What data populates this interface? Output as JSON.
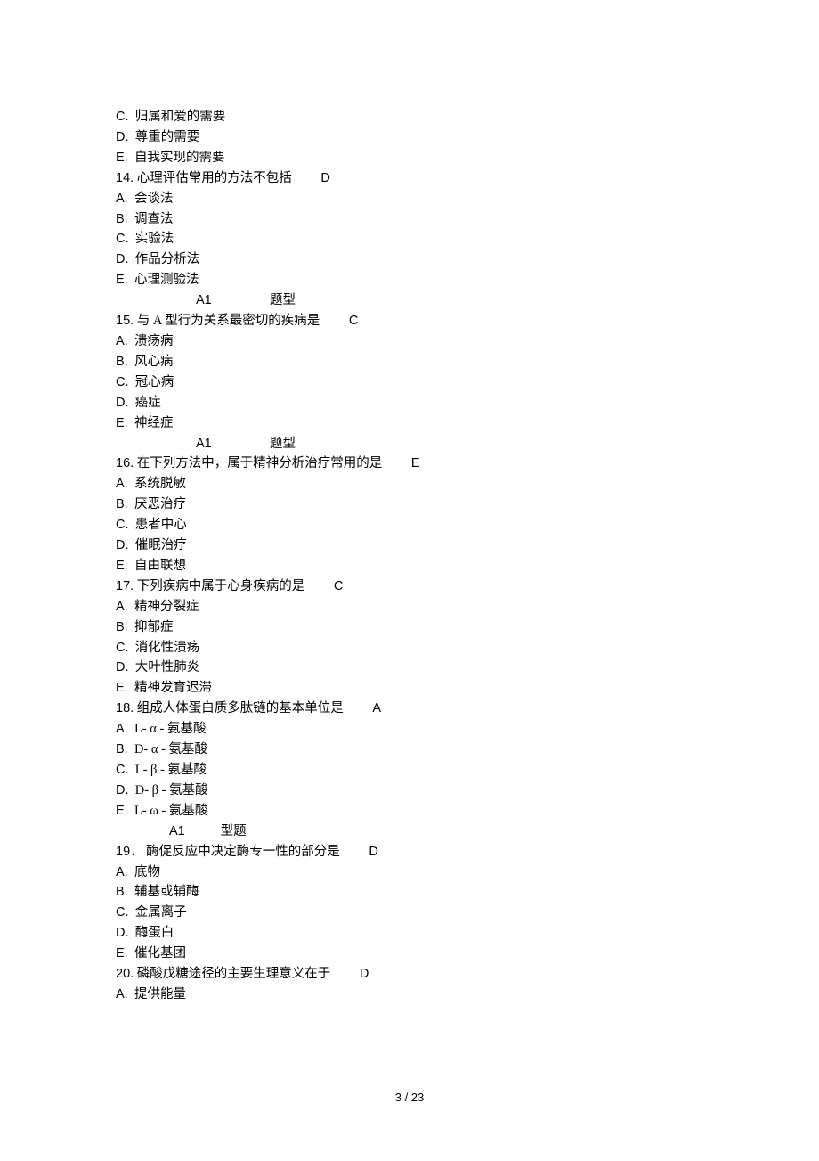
{
  "lines": [
    {
      "t": "opt",
      "label": "C.",
      "text": "归属和爱的需要"
    },
    {
      "t": "opt",
      "label": "D.",
      "text": "尊重的需要"
    },
    {
      "t": "opt",
      "label": "E.",
      "text": "自我实现的需要"
    },
    {
      "t": "q",
      "num": "14.",
      "text": "心理评估常用的方法不包括",
      "ans": "D",
      "gap": "         "
    },
    {
      "t": "opt",
      "label": "A.",
      "text": "会谈法"
    },
    {
      "t": "opt",
      "label": "B.",
      "text": "调查法"
    },
    {
      "t": "opt",
      "label": "C.",
      "text": "实验法"
    },
    {
      "t": "opt",
      "label": "D.",
      "text": "作品分析法"
    },
    {
      "t": "opt",
      "label": "E.",
      "text": "心理测验法"
    },
    {
      "t": "hdr",
      "a1": "A1",
      "mid": "                  ",
      "rest": "题型"
    },
    {
      "t": "q",
      "num": "15.",
      "text": "与 A 型行为关系最密切的疾病是",
      "ans": "C",
      "gap": "         "
    },
    {
      "t": "opt",
      "label": "A.",
      "text": "溃疡病"
    },
    {
      "t": "opt",
      "label": "B.",
      "text": "风心病"
    },
    {
      "t": "opt",
      "label": "C.",
      "text": "冠心病"
    },
    {
      "t": "opt",
      "label": "D.",
      "text": "癌症"
    },
    {
      "t": "opt",
      "label": "E.",
      "text": "神经症"
    },
    {
      "t": "hdr",
      "a1": "A1",
      "mid": "                  ",
      "rest": "题型"
    },
    {
      "t": "q",
      "num": "16.",
      "text": "在下列方法中，属于精神分析治疗常用的是",
      "ans": "E",
      "gap": "         "
    },
    {
      "t": "opt",
      "label": "A.",
      "text": "系统脱敏"
    },
    {
      "t": "opt",
      "label": "B.",
      "text": "厌恶治疗"
    },
    {
      "t": "opt",
      "label": "C.",
      "text": "患者中心"
    },
    {
      "t": "opt",
      "label": "D.",
      "text": "催眠治疗"
    },
    {
      "t": "opt",
      "label": "E.",
      "text": "自由联想"
    },
    {
      "t": "q",
      "num": "17.",
      "text": "下列疾病中属于心身疾病的是",
      "ans": "C",
      "gap": "         "
    },
    {
      "t": "opt",
      "label": "A.",
      "text": "精神分裂症"
    },
    {
      "t": "opt",
      "label": "B.",
      "text": "抑郁症"
    },
    {
      "t": "opt",
      "label": "C.",
      "text": "消化性溃疡"
    },
    {
      "t": "opt",
      "label": "D.",
      "text": "大叶性肺炎"
    },
    {
      "t": "opt",
      "label": "E.",
      "text": "精神发育迟滞"
    },
    {
      "t": "q",
      "num": "18.",
      "text": "组成人体蛋白质多肽链的基本单位是",
      "ans": "A",
      "gap": "         "
    },
    {
      "t": "opt",
      "label": "A.",
      "text": "L- α - 氨基酸"
    },
    {
      "t": "opt",
      "label": "B.",
      "text": "D- α - 氨基酸"
    },
    {
      "t": "opt",
      "label": "C.",
      "text": "L- β - 氨基酸"
    },
    {
      "t": "opt",
      "label": "D.",
      "text": "D- β - 氨基酸"
    },
    {
      "t": "opt",
      "label": "E.",
      "text": "L- ω - 氨基酸"
    },
    {
      "t": "hdr2",
      "a1": "A1",
      "mid": "           ",
      "rest": "型题"
    },
    {
      "t": "q",
      "num": "19．",
      "text": "酶促反应中决定酶专一性的部分是",
      "ans": "D",
      "gap": "         "
    },
    {
      "t": "opt",
      "label": "A.",
      "text": "底物"
    },
    {
      "t": "opt",
      "label": "B.",
      "text": "辅基或辅酶"
    },
    {
      "t": "opt",
      "label": "C.",
      "text": "金属离子"
    },
    {
      "t": "opt",
      "label": "D.",
      "text": "酶蛋白"
    },
    {
      "t": "opt",
      "label": "E.",
      "text": "催化基团"
    },
    {
      "t": "q",
      "num": "20.",
      "text": "磷酸戊糖途径的主要生理意义在于",
      "ans": "D",
      "gap": "         "
    },
    {
      "t": "opt",
      "label": "A.",
      "text": "提供能量"
    }
  ],
  "footer": "3 / 23"
}
